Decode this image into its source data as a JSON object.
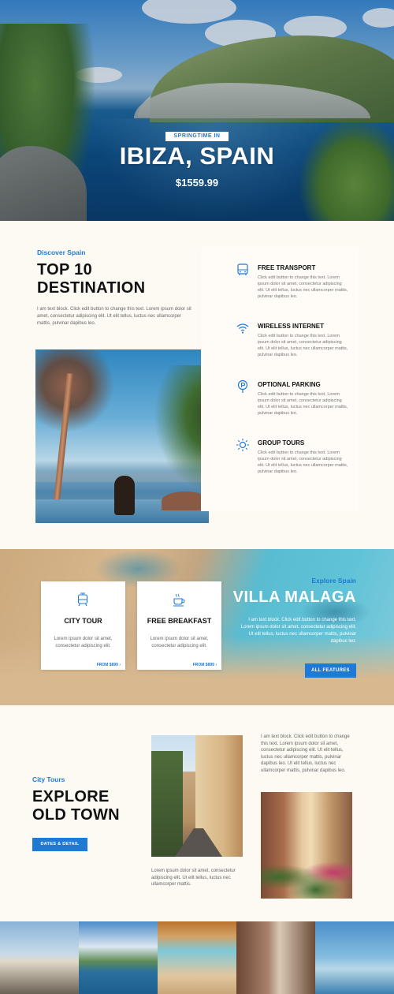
{
  "hero": {
    "badge": "SPRINGTIME IN",
    "title": "IBIZA, SPAIN",
    "price": "$1559.99"
  },
  "discover": {
    "label": "Discover Spain",
    "title_line1": "TOP 10",
    "title_line2": "DESTINATION",
    "text": "I am text block. Click edit button to change this text. Lorem ipsum dolor sit amet, consectetur adipiscing elit. Ut elit tellus, luctus nec ullamcorper mattis, pulvinar dapibus leo."
  },
  "features": [
    {
      "icon": "bus-icon",
      "title": "FREE TRANSPORT",
      "text": "Click edit button to change this text. Lorem ipsum dolor sit amet, consectetur adipiscing elit. Ut elit tellus, luctus nec ullamcorper mattis, pulvinar dapibus leo."
    },
    {
      "icon": "wifi-icon",
      "title": "WIRELESS INTERNET",
      "text": "Click edit button to change this text. Lorem ipsum dolor sit amet, consectetur adipiscing elit. Ut elit tellus, luctus nec ullamcorper mattis, pulvinar dapibus leo."
    },
    {
      "icon": "parking-icon",
      "title": "OPTIONAL PARKING",
      "text": "Click edit button to change this text. Lorem ipsum dolor sit amet, consectetur adipiscing elit. Ut elit tellus, luctus nec ullamcorper mattis, pulvinar dapibus leo."
    },
    {
      "icon": "sun-icon",
      "title": "GROUP TOURS",
      "text": "Click edit button to change this text. Lorem ipsum dolor sit amet, consectetur adipiscing elit. Ut elit tellus, luctus nec ullamcorper mattis, pulvinar dapibus leo."
    }
  ],
  "villa": {
    "cards": [
      {
        "icon": "tram-icon",
        "title": "CITY TOUR",
        "text": "Lorem ipsum dolor sit amet, consectetur adipiscing elit.",
        "link": "FROM $899 ›"
      },
      {
        "icon": "coffee-icon",
        "title": "FREE BREAKFAST",
        "text": "Lorem ipsum dolor sit amet, consectetur adipiscing elit.",
        "link": "FROM $899 ›"
      }
    ],
    "label": "Explore Spain",
    "title": "VILLA MALAGA",
    "text": "I am text block. Click edit button to change this text. Lorem ipsum dolor sit amet, consectetur adipiscing elit. Ut elit tellus, luctus nec ullamcorper mattis, pulvinar dapibus leo.",
    "button": "ALL FEATURES"
  },
  "oldtown": {
    "label": "City Tours",
    "title_line1": "EXPLORE",
    "title_line2": "OLD TOWN",
    "button": "DATES & DETAIL",
    "text_right": "I am text block. Click edit button to change this text. Lorem ipsum dolor sit amet, consectetur adipiscing elit. Ut elit tellus, luctus nec ullamcorper mattis, pulvinar dapibus leo. Ut elit tellus, luctus nec ullamcorper mattis, pulvinar dapibus leo.",
    "text_bottom": "Lorem ipsum dolor sit amet, consectetur adipiscing elit. Ut elit tellus, luctus nec ullamcorper mattis."
  },
  "colors": {
    "accent": "#1f7ad6",
    "background": "#fdfaf4"
  }
}
